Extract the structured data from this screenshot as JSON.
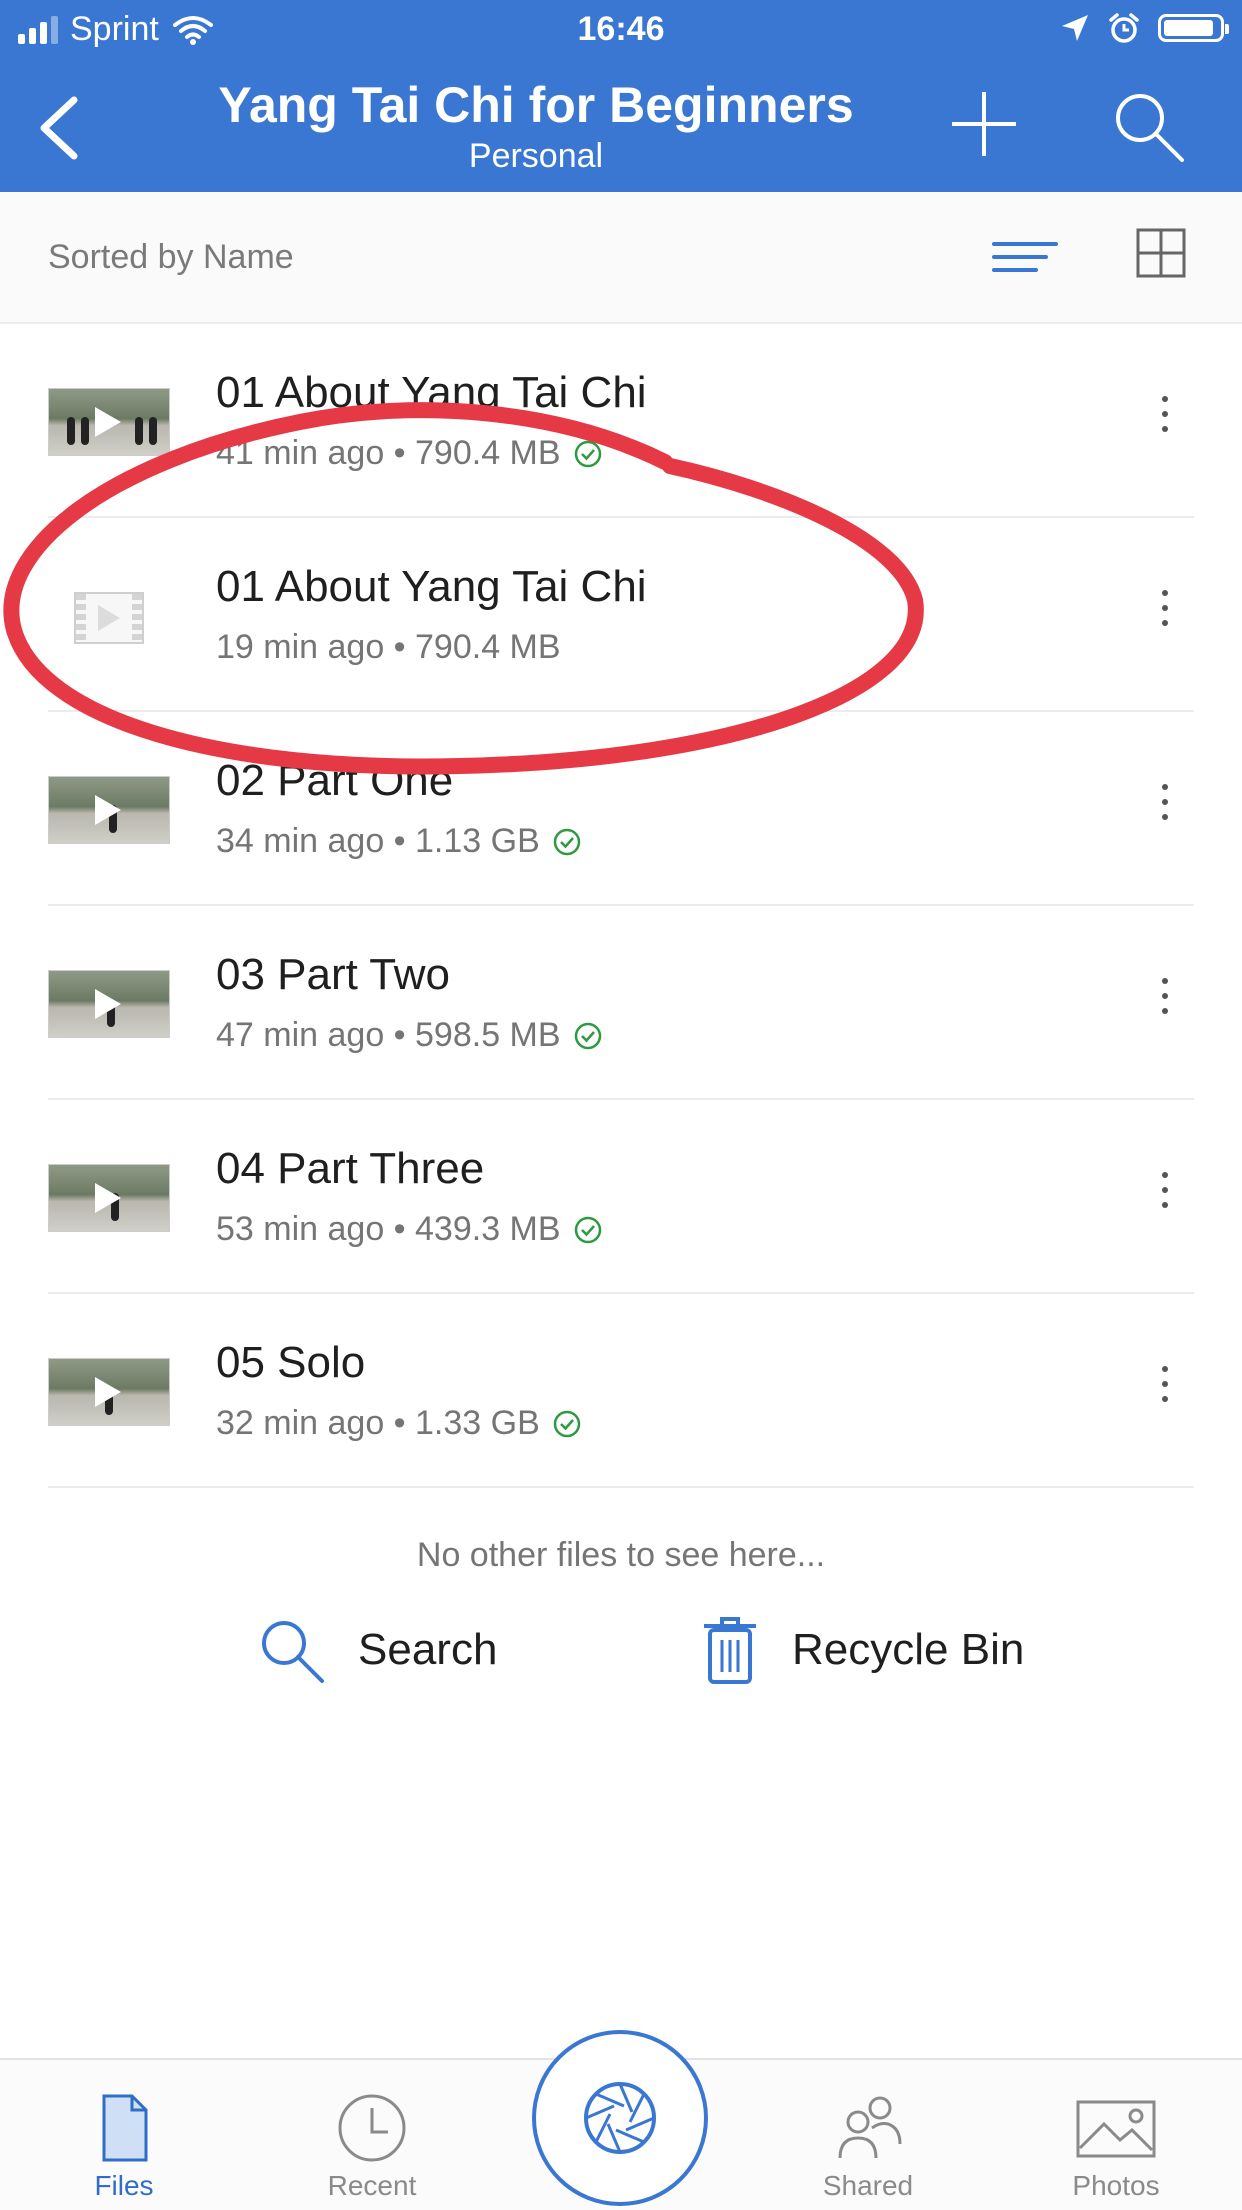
{
  "status_bar": {
    "carrier": "Sprint",
    "time": "16:46",
    "battery_level": 0.9
  },
  "header": {
    "title": "Yang Tai Chi for Beginners",
    "subtitle": "Personal",
    "background_color": "#3a77d2"
  },
  "sort": {
    "label": "Sorted by Name"
  },
  "files": [
    {
      "name": "01 About Yang Tai Chi",
      "meta": "41 min ago • 790.4 MB",
      "synced": true,
      "thumb": "video"
    },
    {
      "name": "01 About Yang Tai Chi",
      "meta": "19 min ago • 790.4 MB",
      "synced": false,
      "thumb": "placeholder"
    },
    {
      "name": "02 Part One",
      "meta": "34 min ago • 1.13 GB",
      "synced": true,
      "thumb": "video"
    },
    {
      "name": "03 Part Two",
      "meta": "47 min ago • 598.5 MB",
      "synced": true,
      "thumb": "video"
    },
    {
      "name": "04 Part Three",
      "meta": "53 min ago • 439.3 MB",
      "synced": true,
      "thumb": "video"
    },
    {
      "name": "05 Solo",
      "meta": "32 min ago • 1.33 GB",
      "synced": true,
      "thumb": "video"
    }
  ],
  "footer": {
    "empty_note": "No other files to see here...",
    "search_label": "Search",
    "recycle_label": "Recycle Bin"
  },
  "tabs": [
    {
      "label": "Files",
      "icon": "file-icon",
      "active": true
    },
    {
      "label": "Recent",
      "icon": "clock-icon",
      "active": false
    },
    {
      "label": "Shared",
      "icon": "people-icon",
      "active": false
    },
    {
      "label": "Photos",
      "icon": "photo-icon",
      "active": false
    }
  ],
  "colors": {
    "accent": "#3a77d2",
    "check": "#2e9a3f",
    "annotation": "#e63946"
  }
}
